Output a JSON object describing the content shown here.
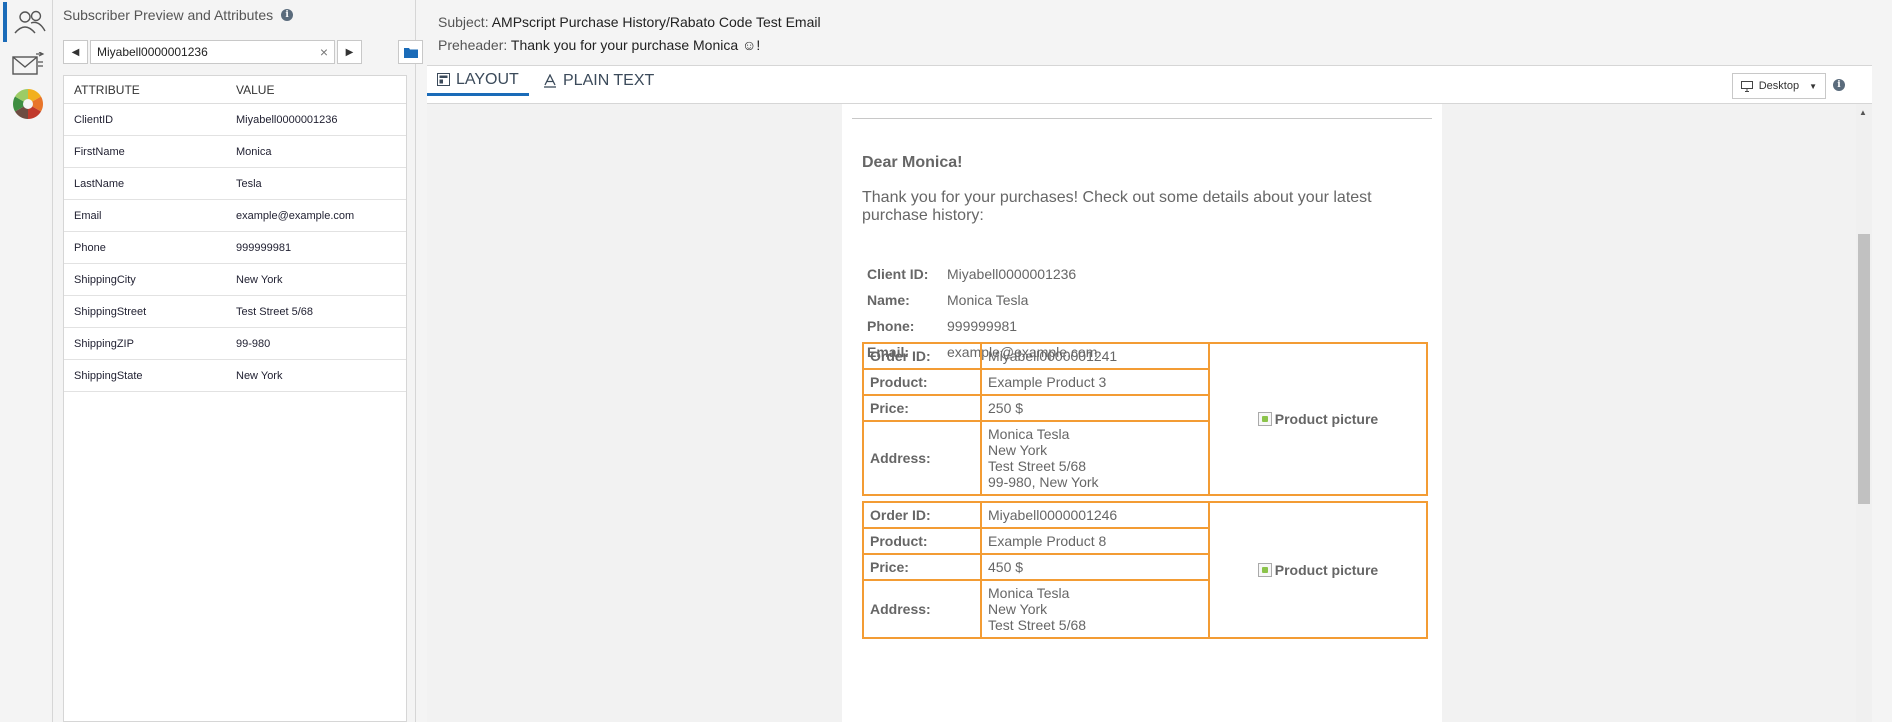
{
  "rail": {
    "items": [
      {
        "icon": "subscribers-icon"
      },
      {
        "icon": "email-send-icon"
      },
      {
        "icon": "color-wheel-icon"
      }
    ]
  },
  "panel": {
    "title": "Subscriber Preview and Attributes",
    "search_value": "Miyabell0000001236",
    "headers": {
      "attribute": "ATTRIBUTE",
      "value": "VALUE"
    },
    "rows": [
      {
        "attribute": "ClientID",
        "value": "Miyabell0000001236"
      },
      {
        "attribute": "FirstName",
        "value": "Monica"
      },
      {
        "attribute": "LastName",
        "value": "Tesla"
      },
      {
        "attribute": "Email",
        "value": "example@example.com"
      },
      {
        "attribute": "Phone",
        "value": "999999981"
      },
      {
        "attribute": "ShippingCity",
        "value": "New York"
      },
      {
        "attribute": "ShippingStreet",
        "value": "Test Street 5/68"
      },
      {
        "attribute": "ShippingZIP",
        "value": "99-980"
      },
      {
        "attribute": "ShippingState",
        "value": "New York"
      }
    ]
  },
  "header": {
    "subject_label": "Subject:",
    "subject": "AMPscript Purchase History/Rabato Code Test Email",
    "preheader_label": "Preheader:",
    "preheader": "Thank you for your purchase Monica ☺!"
  },
  "tabs": {
    "layout": "LAYOUT",
    "plain_text": "PLAIN TEXT",
    "device": "Desktop"
  },
  "email": {
    "greeting": "Dear Monica!",
    "intro": "Thank you for your purchases! Check out some details about your latest purchase history:",
    "info": [
      {
        "label": "Client ID:",
        "value": "Miyabell0000001236"
      },
      {
        "label": "Name:",
        "value": "Monica Tesla"
      },
      {
        "label": "Phone:",
        "value": "999999981"
      },
      {
        "label": "Email:",
        "value": "example@example.com"
      }
    ],
    "orders": [
      {
        "order_label": "Order ID:",
        "order_id": "Miyabell0000001241",
        "product_label": "Product:",
        "product": "Example Product 3",
        "price_label": "Price:",
        "price": "250 $",
        "address_label": "Address:",
        "address": [
          "Monica Tesla",
          "New York",
          "Test Street 5/68",
          "99-980, New York"
        ],
        "picture_alt": "Product picture"
      },
      {
        "order_label": "Order ID:",
        "order_id": "Miyabell0000001246",
        "product_label": "Product:",
        "product": "Example Product 8",
        "price_label": "Price:",
        "price": "450 $",
        "address_label": "Address:",
        "address": [
          "Monica Tesla",
          "New York",
          "Test Street 5/68"
        ],
        "picture_alt": "Product picture"
      }
    ]
  },
  "colors": {
    "accent": "#1a6bb8",
    "order_border": "#f39c34"
  }
}
